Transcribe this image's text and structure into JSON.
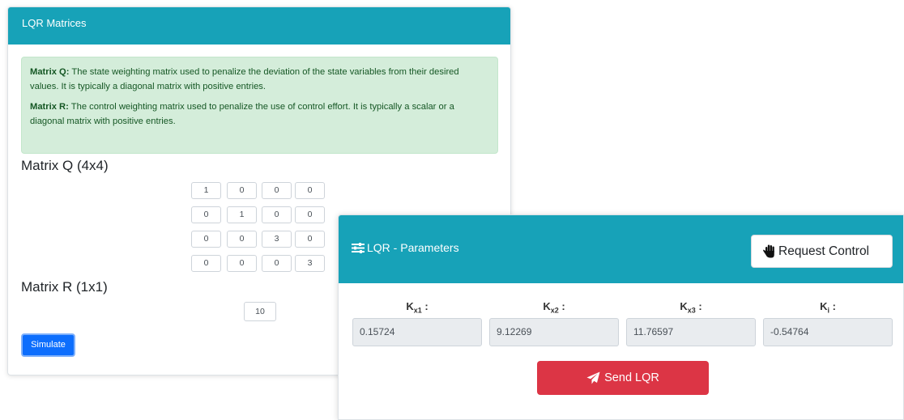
{
  "matrices_card": {
    "title": "LQR Matrices",
    "info": {
      "q_label": "Matrix Q:",
      "q_text": " The state weighting matrix used to penalize the deviation of the state variables from their desired values. It is typically a diagonal matrix with positive entries.",
      "r_label": "Matrix R:",
      "r_text": " The control weighting matrix used to penalize the use of control effort. It is typically a scalar or a diagonal matrix with positive entries."
    },
    "q_title": "Matrix Q (4x4)",
    "q_values": [
      [
        "1",
        "0",
        "0",
        "0"
      ],
      [
        "0",
        "1",
        "0",
        "0"
      ],
      [
        "0",
        "0",
        "3",
        "0"
      ],
      [
        "0",
        "0",
        "0",
        "3"
      ]
    ],
    "r_title": "Matrix R (1x1)",
    "r_value": "10",
    "simulate_label": "Simulate"
  },
  "params_card": {
    "title": "LQR - Parameters",
    "title_icon": "sliders-icon",
    "request_control_label": "Request Control",
    "request_icon": "hand-icon",
    "gains": [
      {
        "base": "K",
        "sub": "x1",
        "suffix": " :",
        "value": "0.15724"
      },
      {
        "base": "K",
        "sub": "x2",
        "suffix": " :",
        "value": "9.12269"
      },
      {
        "base": "K",
        "sub": "x3",
        "suffix": " :",
        "value": "11.76597"
      },
      {
        "base": "K",
        "sub": "i",
        "suffix": " :",
        "value": "-0.54764"
      }
    ],
    "send_label": "Send LQR",
    "send_icon": "paper-plane-icon"
  },
  "colors": {
    "header": "#17a2b8",
    "info_bg": "#d4edda",
    "info_text": "#155724",
    "primary": "#0d6efd",
    "danger": "#dc3545"
  }
}
